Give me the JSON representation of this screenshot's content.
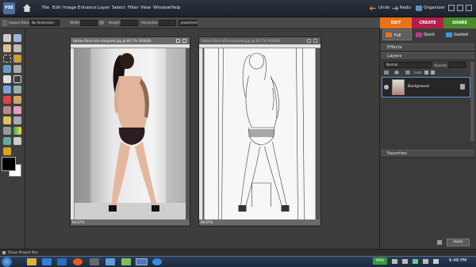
{
  "app": {
    "logo_text": "PSE",
    "menus": [
      "File",
      "Edit",
      "Image",
      "Enhance",
      "Layer",
      "Select",
      "Filter",
      "View",
      "Window",
      "Help"
    ],
    "undo_label": "Undo",
    "redo_label": "Redo",
    "organizer_label": "Organizer"
  },
  "modes": {
    "edit": "EDIT",
    "create": "CREATE",
    "share": "SHARE"
  },
  "options_bar": {
    "aspect_label": "Aspect Ratio:",
    "aspect_value": "No Restriction",
    "width_label": "Width:",
    "height_label": "Height:",
    "resolution_label": "Resolution:",
    "resolution_unit": "pixels/inch"
  },
  "documents": [
    {
      "title": "tattoo-flash-non-shopped.jpg @ 66.7% (RGB/8)",
      "zoom": "66.67%"
    },
    {
      "title": "tattoo-flash-aftershopped.jpg @ 66.7% (RGB/8)",
      "zoom": "66.67%"
    }
  ],
  "edit_tabs": {
    "full": "Full",
    "quick": "Quick",
    "guided": "Guided"
  },
  "panels": {
    "effects": "Effects",
    "layers": "Layers",
    "blend_mode": "Normal",
    "opacity_label": "Opacity:",
    "lock_label": "Lock:",
    "layer_name": "Background",
    "favorites": "Favorites",
    "apply_label": "Apply"
  },
  "bottom": {
    "project_bin": "Show Project Bin",
    "battery": "99%",
    "clock": "6:48 PM"
  },
  "colors": {
    "edit_tab": "#e8731a",
    "create_tab": "#b0204a",
    "share_tab": "#4a8a2a",
    "selection": "#5a8fd8"
  }
}
